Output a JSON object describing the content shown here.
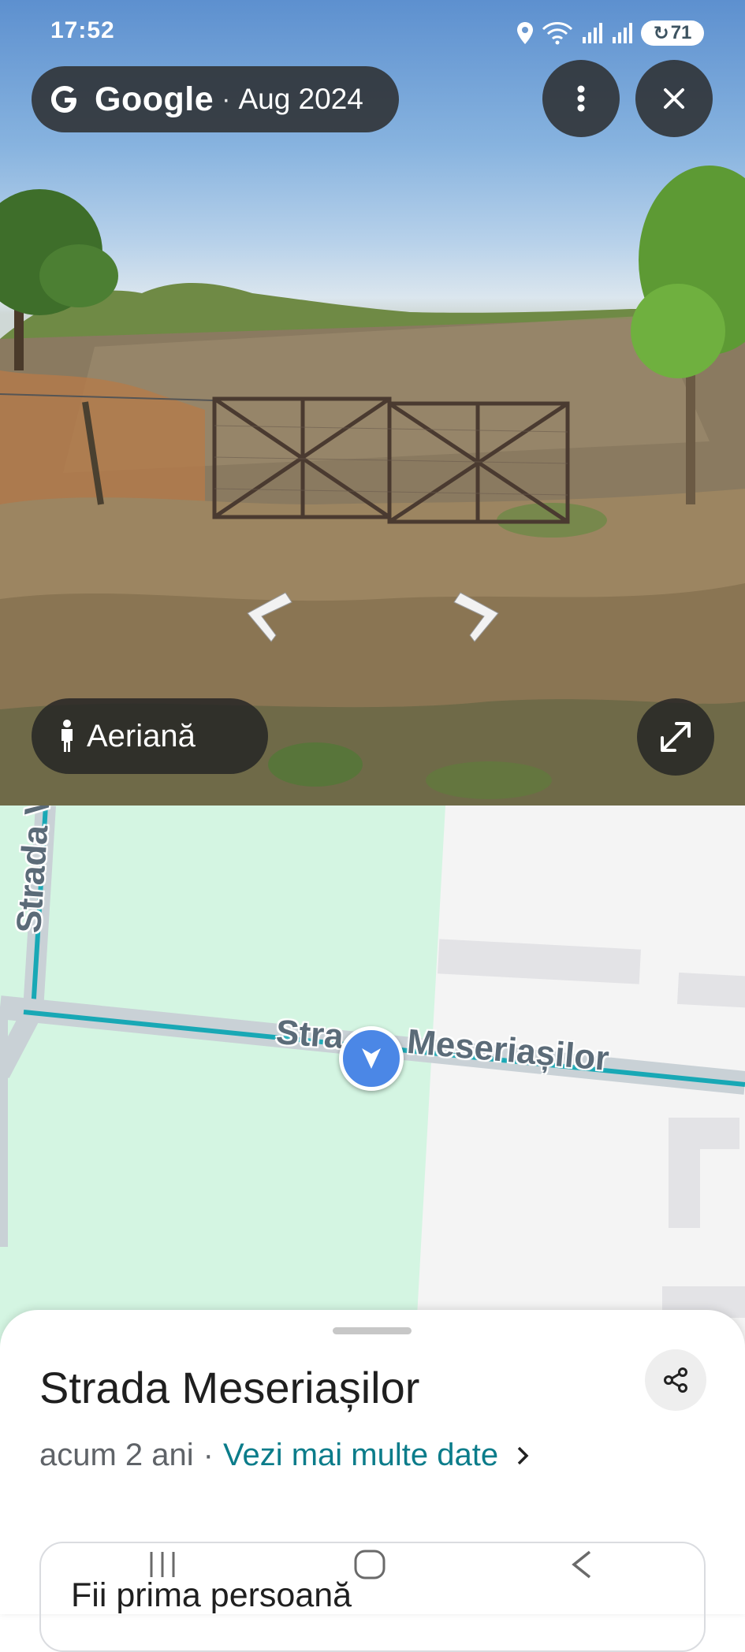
{
  "status_bar": {
    "time": "17:52",
    "battery": "71",
    "icons": [
      "location-icon",
      "wifi-6-icon",
      "signal-icon",
      "signal-icon-2",
      "battery-saver-icon"
    ]
  },
  "streetview": {
    "brand": "Google",
    "separator": "·",
    "capture_date": "Aug 2024",
    "menu_icon": "more-vert-icon",
    "close_icon": "close-icon",
    "aerial_label": "Aeriană",
    "expand_icon": "expand-icon",
    "nav_left_icon": "chevron-left-icon",
    "nav_right_icon": "chevron-right-icon"
  },
  "map": {
    "road_main": "Strada Meseriașilor",
    "road_main_left": "Stra",
    "road_main_right": "Meseriașilor",
    "road_side": "Strada Va",
    "colors": {
      "park": "#d4f5e2",
      "route": "#18a8b5",
      "pin": "#4b87e6",
      "background": "#f4f4f4"
    }
  },
  "sheet": {
    "title": "Strada Meseriașilor",
    "age": "acum 2 ani",
    "separator": "·",
    "more_dates_link": "Vezi mai multe date",
    "card_text": "Fii prima persoană",
    "share_icon": "share-icon"
  },
  "navbar": {
    "icons": [
      "recents-icon",
      "home-icon",
      "back-icon"
    ]
  }
}
